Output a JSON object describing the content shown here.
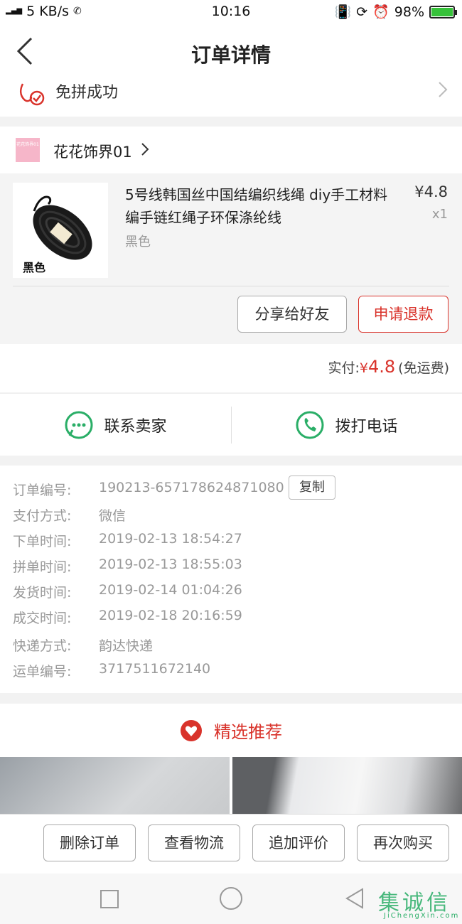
{
  "status_bar": {
    "signal_text": "3G 4G",
    "speed": "5 KB/s",
    "hd": "HD",
    "time": "10:16",
    "battery": "98%"
  },
  "header": {
    "title": "订单详情"
  },
  "group_status": {
    "label": "免拼成功"
  },
  "shop": {
    "logo_text": "花花饰界01",
    "name": "花花饰界01"
  },
  "product": {
    "title": "5号线韩国丝中国结编织线绳 diy手工材料编手链红绳子环保涤纶线",
    "price": "¥4.8",
    "qty": "x1",
    "variant": "黑色",
    "thumb_label": "黑色",
    "share_button": "分享给好友",
    "refund_button": "申请退款"
  },
  "payment": {
    "label": "实付:",
    "currency": "¥",
    "amount": "4.8",
    "note": "(免运费)"
  },
  "contact": {
    "seller": "联系卖家",
    "phone": "拨打电话"
  },
  "order_info": {
    "copy_button": "复制",
    "rows": [
      {
        "k": "订单编号:",
        "v": "190213-657178624871080"
      },
      {
        "k": "支付方式:",
        "v": "微信"
      },
      {
        "k": "下单时间:",
        "v": "2019-02-13 18:54:27"
      },
      {
        "k": "拼单时间:",
        "v": "2019-02-13 18:55:03"
      },
      {
        "k": "发货时间:",
        "v": "2019-02-14 01:04:26"
      },
      {
        "k": "成交时间:",
        "v": "2019-02-18 20:16:59"
      },
      {
        "k": "快递方式:",
        "v": "韵达快递"
      },
      {
        "k": "运单编号:",
        "v": "3717511672140"
      }
    ]
  },
  "recommend": {
    "title": "精选推荐"
  },
  "actions": {
    "delete": "删除订单",
    "logistics": "查看物流",
    "review": "追加评价",
    "rebuy": "再次购买"
  },
  "watermark": {
    "cn": "集诚信",
    "en": "JiChengXin.com"
  },
  "colors": {
    "accent": "#d9332b",
    "wechat_green": "#2aae67"
  }
}
